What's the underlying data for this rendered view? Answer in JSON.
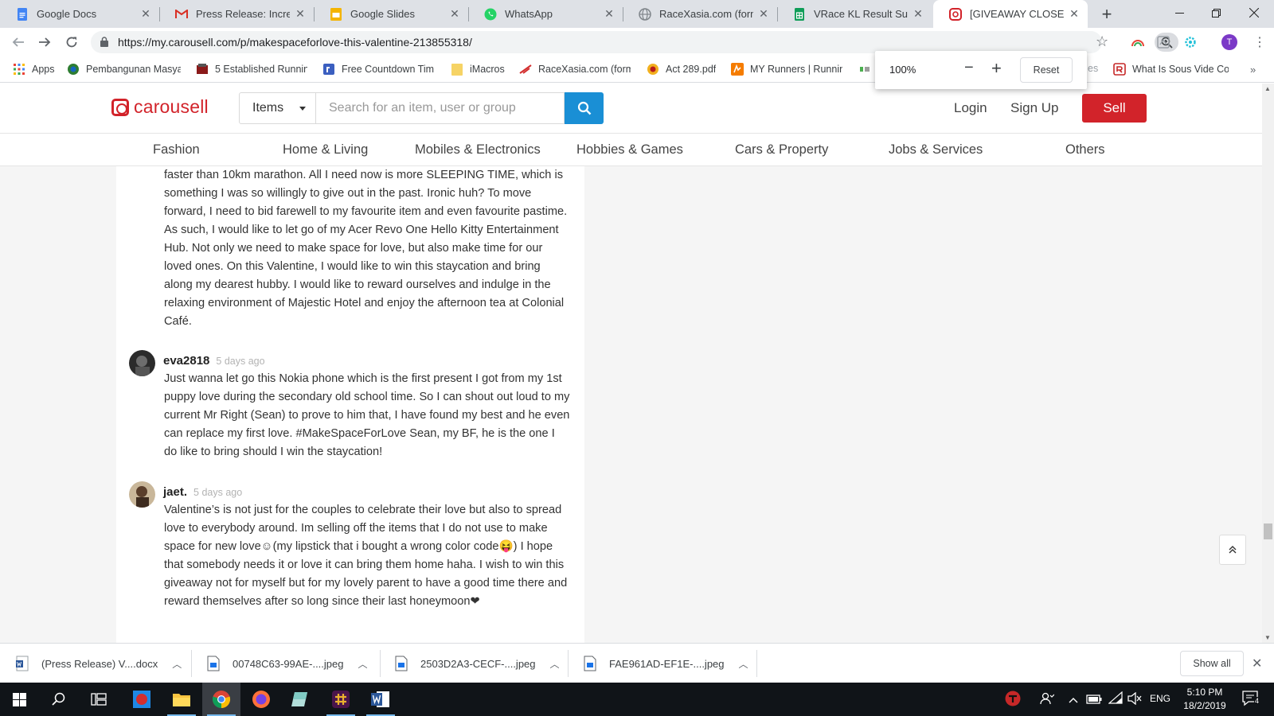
{
  "browser": {
    "tabs": [
      {
        "title": "Google Docs",
        "icon": "google-docs-icon",
        "color": "#4285f4"
      },
      {
        "title": "Press Release: Increase",
        "icon": "gmail-icon",
        "color": "#d93025"
      },
      {
        "title": "Google Slides",
        "icon": "google-slides-icon",
        "color": "#f4b400"
      },
      {
        "title": "WhatsApp",
        "icon": "whatsapp-icon",
        "color": "#25d366"
      },
      {
        "title": "RaceXasia.com (former",
        "icon": "globe-icon",
        "color": "#9aa0a6"
      },
      {
        "title": "VRace KL Result Submi",
        "icon": "google-sheets-icon",
        "color": "#0f9d58"
      },
      {
        "title": "[GIVEAWAY CLOSED] #",
        "icon": "carousell-icon",
        "color": "#d2232a"
      }
    ],
    "url": "https://my.carousell.com/p/makespaceforlove-this-valentine-213855318/",
    "bookmarks": [
      {
        "label": "Apps",
        "icon": "apps-grid-icon"
      },
      {
        "label": "Pembangunan Masya",
        "icon": "globe-emblem-icon"
      },
      {
        "label": "5 Established Runnin",
        "icon": "bookmark-site-icon"
      },
      {
        "label": "Free Countdown Tim",
        "icon": "countdown-icon"
      },
      {
        "label": "iMacros",
        "icon": "folder-icon"
      },
      {
        "label": "RaceXasia.com (form",
        "icon": "racexasia-icon"
      },
      {
        "label": "Act 289.pdf",
        "icon": "emblem-icon"
      },
      {
        "label": "MY Runners | Runnin",
        "icon": "myrunners-icon"
      },
      {
        "label": "What Is Sous Vide Co",
        "icon": "sous-vide-icon"
      }
    ],
    "bookmark_fragment": "es",
    "zoom": {
      "value": "100%",
      "minus": "−",
      "plus": "+",
      "reset": "Reset"
    },
    "profile_initial": "T"
  },
  "site": {
    "logo": "carousell",
    "search": {
      "category": "Items",
      "placeholder": "Search for an item, user or group"
    },
    "login": "Login",
    "signup": "Sign Up",
    "sell": "Sell",
    "categories": [
      "Fashion",
      "Home & Living",
      "Mobiles & Electronics",
      "Hobbies & Games",
      "Cars & Property",
      "Jobs & Services",
      "Others"
    ],
    "accent": "#d2232a",
    "search_blue": "#1a8fd5"
  },
  "comments": {
    "partial_text": "faster than 10km marathon. All I need now is more SLEEPING TIME, which is something I was so willingly to give out in the past. Ironic huh? To move forward, I need to bid farewell to my favourite item and even favourite pastime. As such, I would like to let go of my Acer Revo One Hello Kitty Entertainment Hub. Not only we need to make space for love, but also make time for our loved ones. On this Valentine, I would like to win this staycation and bring along my dearest hubby. I would like to reward ourselves and indulge in the relaxing environment of Majestic Hotel and enjoy the afternoon tea at Colonial Café.",
    "items": [
      {
        "user": "eva2818",
        "time": "5 days ago",
        "text": "Just wanna let go this Nokia phone which is the first present I got from my 1st puppy love during the secondary old school time. So I can shout out loud to my current Mr Right (Sean) to prove to him that, I have found my best and he even can replace my first love. #MakeSpaceForLove Sean, my BF, he is the one I do like to bring should I win the staycation!"
      },
      {
        "user": "jaet.",
        "time": "5 days ago",
        "text": "Valentine’s is not just for the couples to celebrate their love but also to spread love to everybody around. Im selling off the items that I do not use to make space for new love☺(my lipstick that i bought a wrong color code😝) I hope that somebody needs it or love it can bring them home haha. I wish to win this giveaway not for myself but for my lovely parent to have a good time there and reward themselves after so long since their last honeymoon❤"
      }
    ]
  },
  "downloads": {
    "items": [
      {
        "name": "(Press Release) V....docx",
        "icon": "word-doc-icon"
      },
      {
        "name": "00748C63-99AE-....jpeg",
        "icon": "image-file-icon"
      },
      {
        "name": "2503D2A3-CECF-....jpeg",
        "icon": "image-file-icon"
      },
      {
        "name": "FAE961AD-EF1E-....jpeg",
        "icon": "image-file-icon"
      }
    ],
    "show_all": "Show all"
  },
  "taskbar": {
    "lang": "ENG",
    "time": "5:10 PM",
    "date": "18/2/2019",
    "notifications": "4"
  }
}
